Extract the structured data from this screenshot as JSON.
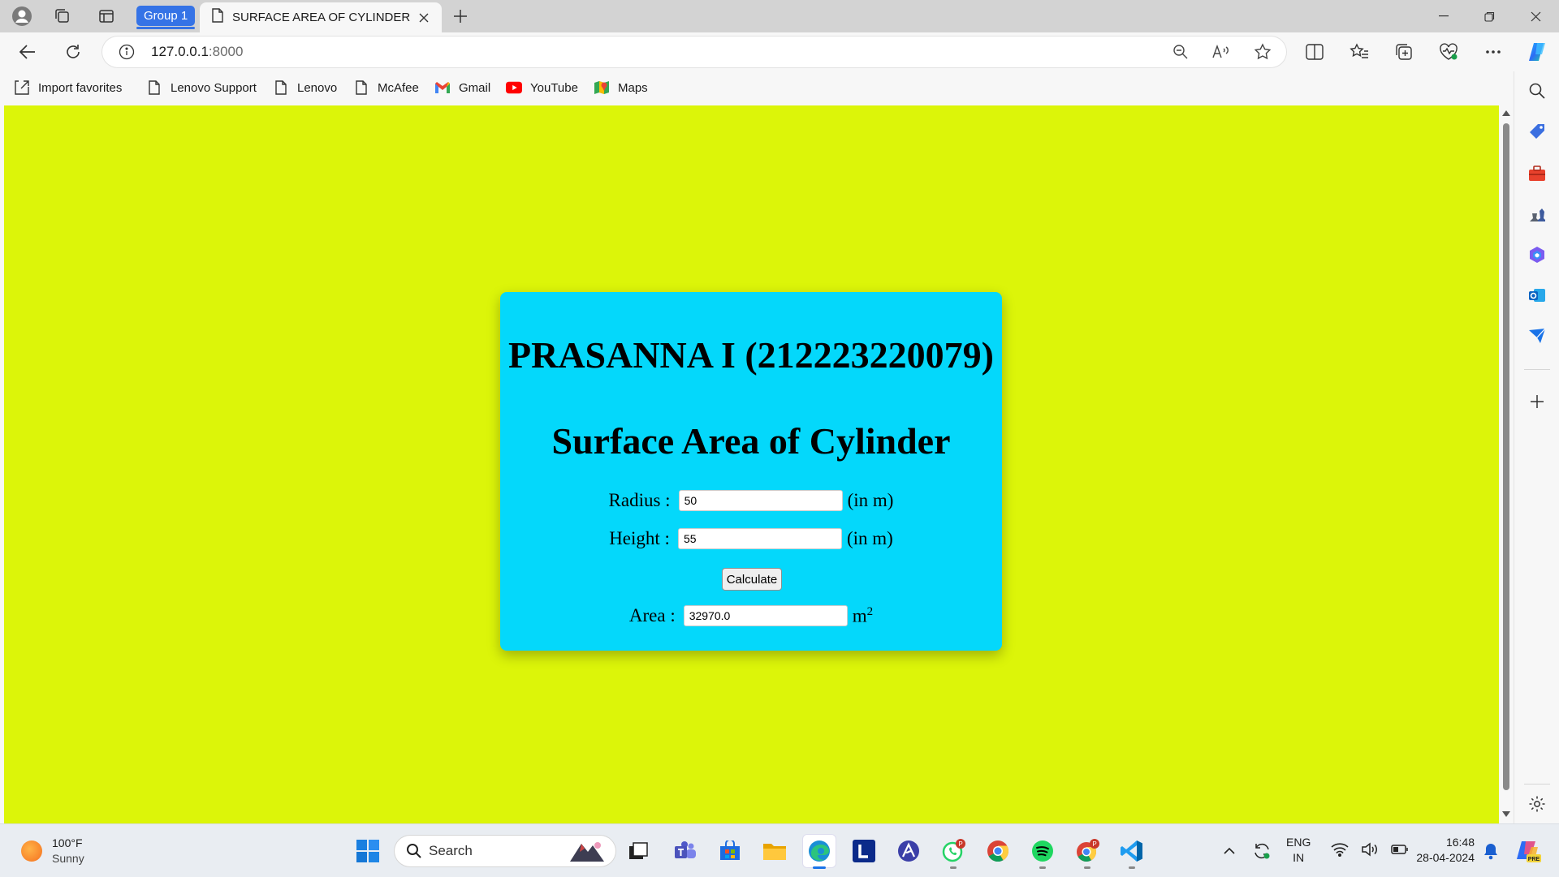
{
  "browser": {
    "group_label": "Group 1",
    "tab_title": "SURFACE AREA OF CYLINDER",
    "url_host": "127.0.0.1",
    "url_port": ":8000",
    "favorites": [
      {
        "label": "Import favorites",
        "icon": "import-icon"
      },
      {
        "label": "Lenovo Support",
        "icon": "page-icon"
      },
      {
        "label": "Lenovo",
        "icon": "page-icon"
      },
      {
        "label": "McAfee",
        "icon": "page-icon"
      },
      {
        "label": "Gmail",
        "icon": "gmail-icon"
      },
      {
        "label": "YouTube",
        "icon": "youtube-icon"
      },
      {
        "label": "Maps",
        "icon": "maps-icon"
      }
    ]
  },
  "page": {
    "background": "#dcf509",
    "card_color": "#04d8fb",
    "name_heading": "PRASANNA I (212223220079)",
    "title": "Surface Area of Cylinder",
    "radius_label": "Radius :",
    "radius_value": "50",
    "height_label": "Height :",
    "height_value": "55",
    "unit_label": "(in m)",
    "calculate_label": "Calculate",
    "area_label": "Area :",
    "area_value": "32970.0",
    "area_unit": "m",
    "area_unit_exp": "2"
  },
  "taskbar": {
    "temperature": "100°F",
    "condition": "Sunny",
    "search_label": "Search",
    "lang_top": "ENG",
    "lang_bottom": "IN",
    "time": "16:48",
    "date": "28-04-2024"
  }
}
